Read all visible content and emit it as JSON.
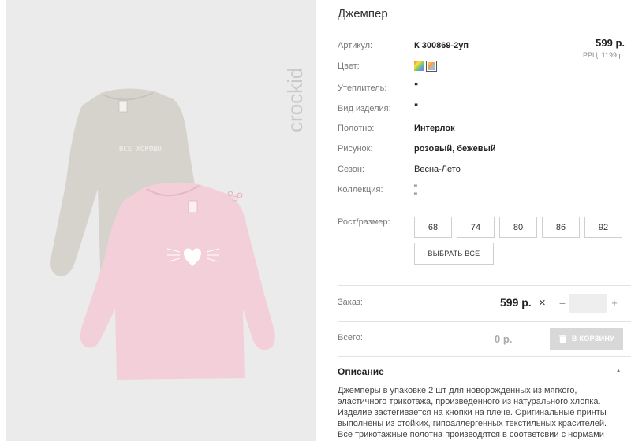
{
  "product": {
    "title": "Джемпер",
    "price": "599 р.",
    "rrp_label": "РРЦ:",
    "rrp_value": "1199 р."
  },
  "brand": {
    "logo_text": "crockid"
  },
  "attributes": {
    "sku_label": "Артикул:",
    "sku_value": "К 300869-2уп",
    "color_label": "Цвет:",
    "insulation_label": "Утеплитель:",
    "insulation_value": "\"",
    "kind_label": "Вид изделия:",
    "kind_value": "\"",
    "fabric_label": "Полотно:",
    "fabric_value": "Интерлок",
    "print_label": "Рисунок:",
    "print_value": "розовый, бежевый",
    "season_label": "Сезон:",
    "season_value": "Весна-Лето",
    "collection_label": "Коллекция:",
    "collection_value_1": "\"",
    "collection_value_2": "\"",
    "size_label": "Рост/размер:"
  },
  "sizes": [
    "68",
    "74",
    "80",
    "86",
    "92"
  ],
  "select_all_label": "ВЫБРАТЬ ВСЕ",
  "order": {
    "label": "Заказ:",
    "price": "599 р.",
    "times": "×",
    "minus": "−",
    "plus": "+",
    "quantity": ""
  },
  "total": {
    "label": "Всего:",
    "value": "0 р.",
    "cart_button": "В КОРЗИНУ"
  },
  "description": {
    "title": "Описание",
    "text": "Джемперы в упаковке 2 шт для новорожденных из мягкого, эластичного трикотажа, произведенного из натурального хлопка. Изделие застегивается на кнопки на плече. Оригинальные принты выполнены из стойких, гипоаллергенных текстильных красителей. Все трикотажные полотна производятся в соответсвии с нормами"
  },
  "colors": {
    "accent_gray": "#d8d8d8",
    "shirt_beige": "#d6d3cd",
    "shirt_pink": "#f3cfd9"
  }
}
